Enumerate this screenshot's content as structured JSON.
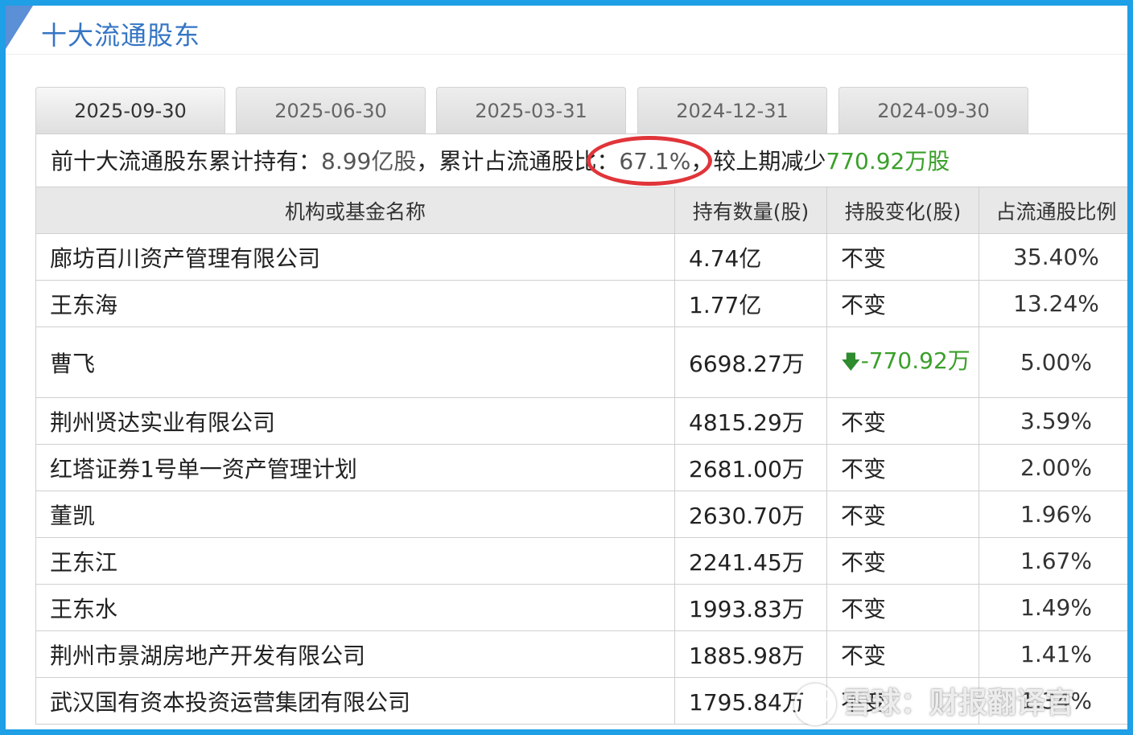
{
  "section": {
    "title": "十大流通股东"
  },
  "tabs": [
    {
      "label": "2025-09-30",
      "active": true
    },
    {
      "label": "2025-06-30",
      "active": false
    },
    {
      "label": "2025-03-31",
      "active": false
    },
    {
      "label": "2024-12-31",
      "active": false
    },
    {
      "label": "2024-09-30",
      "active": false
    }
  ],
  "summary": {
    "prefix": "前十大流通股东累计持有：",
    "total_shares": "8.99亿股",
    "mid": "，累计占流通股比：",
    "ratio": "67.1%",
    "comma": "，",
    "change_prefix": "较上期减少",
    "change_value": "770.92万股"
  },
  "table": {
    "headers": [
      "机构或基金名称",
      "持有数量(股)",
      "持股变化(股)",
      "占流通股比例"
    ],
    "rows": [
      {
        "name": "廊坊百川资产管理有限公司",
        "shares": "4.74亿",
        "change": "不变",
        "ratio": "35.40%"
      },
      {
        "name": "王东海",
        "shares": "1.77亿",
        "change": "不变",
        "ratio": "13.24%"
      },
      {
        "name": "曹飞",
        "shares": "6698.27万",
        "change": "-770.92万",
        "ratio": "5.00%"
      },
      {
        "name": "荆州贤达实业有限公司",
        "shares": "4815.29万",
        "change": "不变",
        "ratio": "3.59%"
      },
      {
        "name": "红塔证券1号单一资产管理计划",
        "shares": "2681.00万",
        "change": "不变",
        "ratio": "2.00%"
      },
      {
        "name": "董凯",
        "shares": "2630.70万",
        "change": "不变",
        "ratio": "1.96%"
      },
      {
        "name": "王东江",
        "shares": "2241.45万",
        "change": "不变",
        "ratio": "1.67%"
      },
      {
        "name": "王东水",
        "shares": "1993.83万",
        "change": "不变",
        "ratio": "1.49%"
      },
      {
        "name": "荆州市景湖房地产开发有限公司",
        "shares": "1885.98万",
        "change": "不变",
        "ratio": "1.41%"
      },
      {
        "name": "武汉国有资本投资运营集团有限公司",
        "shares": "1795.84万",
        "change": "不变",
        "ratio": "1.34%"
      }
    ]
  },
  "watermark": {
    "text": "雪球：财报翻译官",
    "icon": "snowball-logo-icon"
  },
  "colors": {
    "frame": "#1e9fe6",
    "title": "#3575c4",
    "decrease": "#3aa02a",
    "highlight_ring": "#e0353a"
  }
}
